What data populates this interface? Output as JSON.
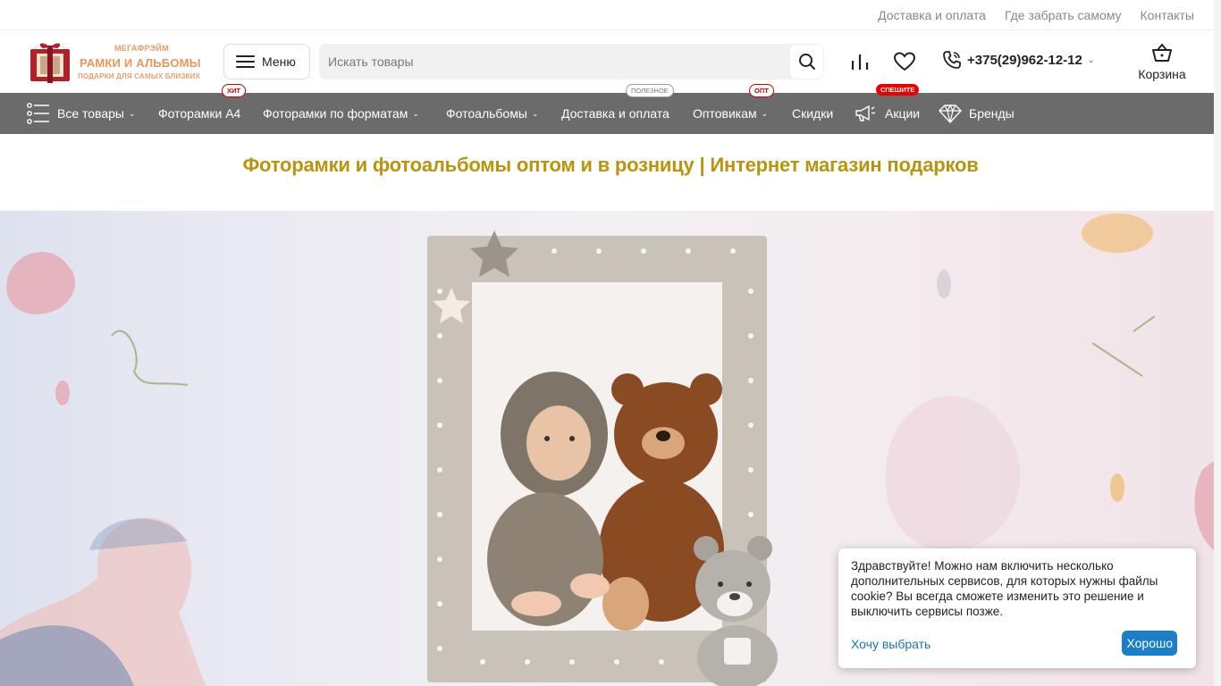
{
  "top_links": [
    "Доставка и оплата",
    "Где забрать самому",
    "Контакты"
  ],
  "logo": {
    "sup": "МЕГАФРЭЙМ",
    "main": "РАМКИ И АЛЬБОМЫ",
    "sub": "ПОДАРКИ ДЛЯ САМЫХ БЛИЗКИХ"
  },
  "header": {
    "menu_label": "Меню",
    "search_placeholder": "Искать товары",
    "phone": "+375(29)962-12-12",
    "cart_label": "Корзина"
  },
  "nav": {
    "items": [
      {
        "label": "Все товары",
        "badge": ""
      },
      {
        "label": "Фоторамки А4",
        "badge": "ХИТ"
      },
      {
        "label": "Фоторамки по форматам",
        "badge": ""
      },
      {
        "label": "Фотоальбомы",
        "badge": ""
      },
      {
        "label": "Доставка и оплата",
        "badge": "ПОЛЕЗНОЕ"
      },
      {
        "label": "Оптовикам",
        "badge": "ОПТ"
      },
      {
        "label": "Скидки",
        "badge": ""
      },
      {
        "label": "Акции",
        "badge": "СПЕШИТЕ"
      },
      {
        "label": "Бренды",
        "badge": ""
      }
    ]
  },
  "page_title": "Фоторамки и фотоальбомы оптом и в розницу | Интернет магазин подарков",
  "cookie": {
    "text": "Здравствуйте! Можно нам включить несколько дополнительных сервисов, для которых нужны файлы cookie? Вы всегда сможете изменить это решение и выключить сервисы позже.",
    "choose": "Хочу выбрать",
    "ok": "Хорошо"
  },
  "colors": {
    "title": "#b9940c",
    "nav_bg": "#6b6b6b",
    "badge_red": "#e00000",
    "link_blue": "#1a73b5",
    "button_blue": "#1a7fc7"
  }
}
